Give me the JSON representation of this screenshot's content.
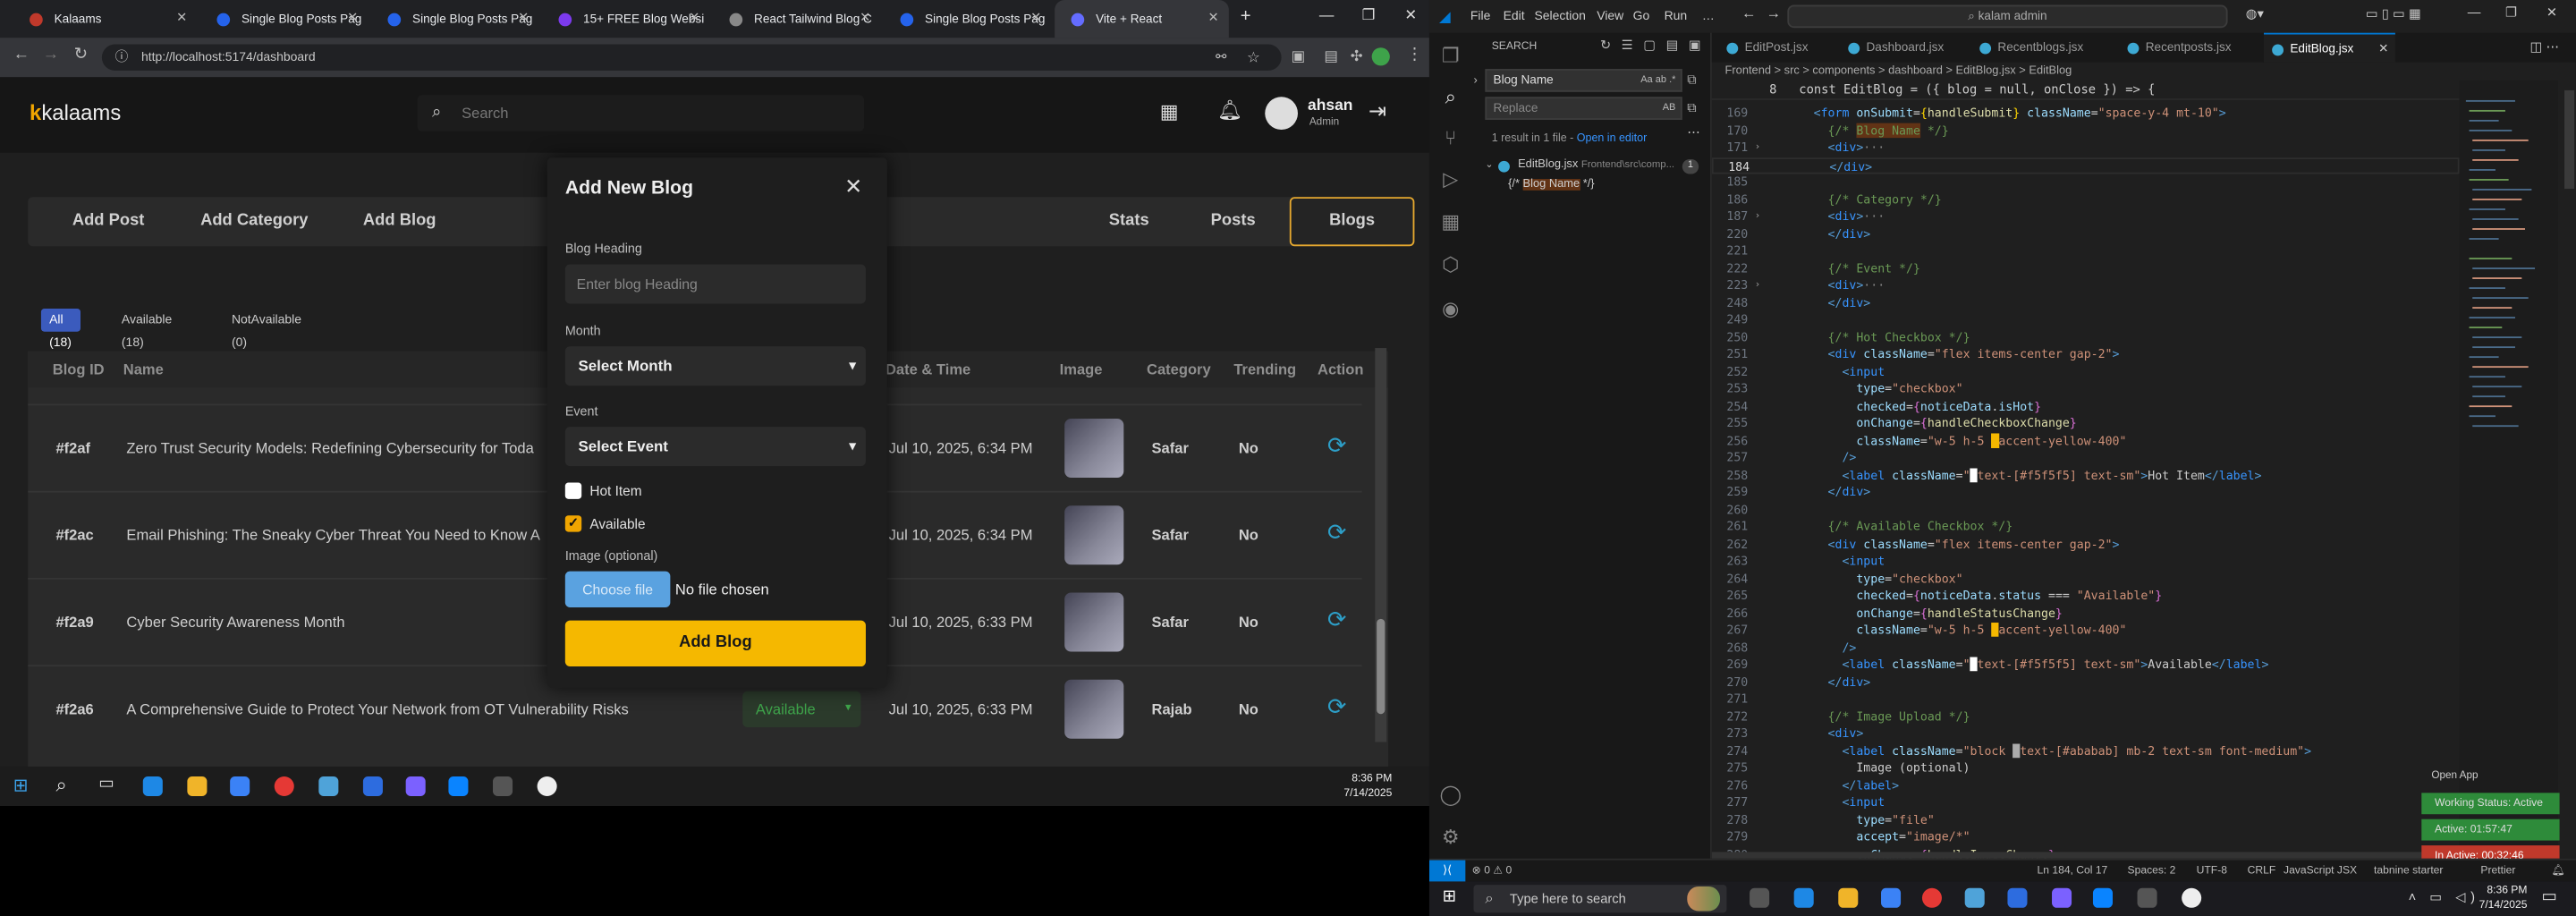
{
  "browser": {
    "tabs": [
      {
        "label": "Kalaams",
        "color": "#c0392b"
      },
      {
        "label": "Single Blog Posts Pag",
        "color": "#2563eb"
      },
      {
        "label": "Single Blog Posts Pag",
        "color": "#2563eb"
      },
      {
        "label": "15+ FREE Blog Websi",
        "color": "#7c3aed"
      },
      {
        "label": "React Tailwind Blog C",
        "color": "#888888"
      },
      {
        "label": "Single Blog Posts Pag",
        "color": "#2563eb"
      },
      {
        "label": "Vite + React",
        "color": "#646cff"
      }
    ],
    "new_tab": "+",
    "url": "http://localhost:5174/dashboard"
  },
  "app": {
    "logo_mark": "k",
    "logo_text": "kalaams",
    "search_placeholder": "Search",
    "user_name": "ahsan",
    "user_role": "Admin",
    "actions": [
      "Add Post",
      "Add Category",
      "Add Blog"
    ],
    "nav": [
      "Stats",
      "Posts",
      "Blogs"
    ],
    "filters": [
      "All (18)",
      "Available (18)",
      "NotAvailable (0)"
    ],
    "columns": [
      "Blog ID",
      "Name",
      "Date & Time",
      "Image",
      "Category",
      "Trending",
      "Action"
    ],
    "rows": [
      {
        "id": "#f2af",
        "name": "Zero Trust Security Models: Redefining Cybersecurity for Toda",
        "date": "Jul 10, 2025, 6:34 PM",
        "category": "Safar",
        "trending": "No"
      },
      {
        "id": "#f2ac",
        "name": "Email Phishing: The Sneaky Cyber Threat You Need to Know A",
        "date": "Jul 10, 2025, 6:34 PM",
        "category": "Safar",
        "trending": "No"
      },
      {
        "id": "#f2a9",
        "name": "Cyber Security Awareness Month",
        "date": "Jul 10, 2025, 6:33 PM",
        "category": "Safar",
        "trending": "No"
      },
      {
        "id": "#f2a6",
        "name": "A Comprehensive Guide to Protect Your Network from OT Vulnerability Risks",
        "date": "Jul 10, 2025, 6:33 PM",
        "category": "Rajab",
        "trending": "No"
      }
    ],
    "status_select": "Available"
  },
  "modal": {
    "title": "Add New Blog",
    "heading_label": "Blog Heading",
    "heading_placeholder": "Enter blog Heading",
    "month_label": "Month",
    "month_value": "Select Month",
    "event_label": "Event",
    "event_value": "Select Event",
    "hot_label": "Hot Item",
    "available_label": "Available",
    "image_label": "Image (optional)",
    "choose_file": "Choose file",
    "no_file": "No file chosen",
    "submit": "Add Blog"
  },
  "guest_taskbar": {
    "time": "8:36 PM",
    "date": "7/14/2025"
  },
  "vscode": {
    "menu": [
      "File",
      "Edit",
      "Selection",
      "View",
      "Go",
      "Run",
      "…"
    ],
    "command_center": "kalam admin",
    "search_title": "SEARCH",
    "find_value": "Blog Name",
    "replace_placeholder": "Replace",
    "result_text": "1 result in 1 file - ",
    "open_editor": "Open in editor",
    "result_file": "EditBlog.jsx",
    "result_path": "Frontend\\src\\comp...",
    "result_count": "1",
    "result_match_prefix": "{/* ",
    "result_match": "Blog Name",
    "result_match_suffix": " */}",
    "editor_tabs": [
      "EditPost.jsx",
      "Dashboard.jsx",
      "Recentblogs.jsx",
      "Recentposts.jsx",
      "EditBlog.jsx"
    ],
    "breadcrumb": "Frontend > src > components > dashboard > EditBlog.jsx > EditBlog",
    "sticky": "8   const EditBlog = ({ blog = null, onClose }) => {",
    "open_app": "Open App",
    "waka_status": "Working Status: Active",
    "waka_active": "Active: 01:57:47",
    "waka_inactive": "In Active: 00:32:46",
    "status": {
      "errors": "⊗ 0 ⚠ 0",
      "cursor": "Ln 184, Col 17",
      "spaces": "Spaces: 2",
      "encoding": "UTF-8",
      "eol": "CRLF",
      "language": "JavaScript JSX",
      "tabnine": "tabnine starter",
      "prettier": "Prettier"
    }
  },
  "host_taskbar": {
    "search_placeholder": "Type here to search",
    "time": "8:36 PM",
    "date": "7/14/2025"
  },
  "colors": {
    "accent": "#f5b800",
    "link_blue": "#2d9ec7",
    "vscode_blue": "#0078d4",
    "waka_green": "#2e8b3a",
    "waka_red": "#c0392b"
  }
}
